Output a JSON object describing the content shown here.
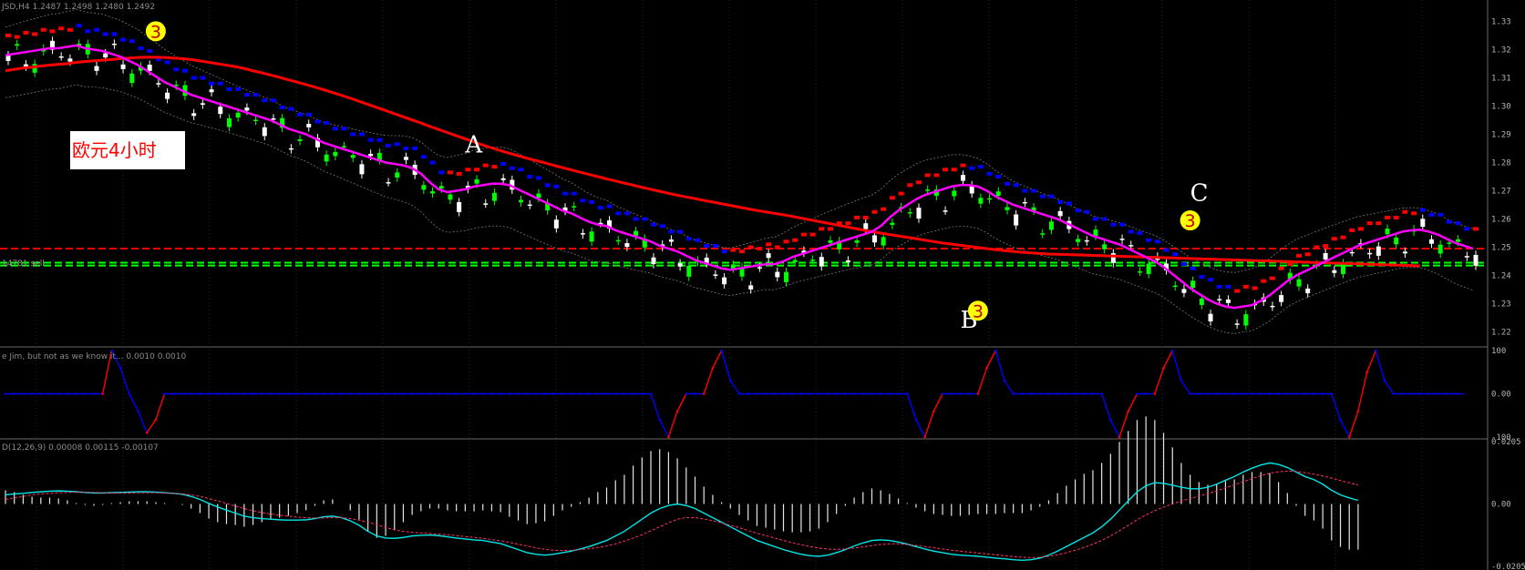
{
  "main": {
    "symbol_title": "JSD,H4  1.2487 1.2498 1.2480 1.2492",
    "note_label": "欧元4小时",
    "point_labels": [
      "A",
      "B",
      "C"
    ],
    "wave_marks": [
      "3",
      "3",
      "3"
    ],
    "sell_label": "14781 sell",
    "price_labels": [
      "1.33",
      "1.32",
      "1.31",
      "1.30",
      "1.29",
      "1.28",
      "1.27",
      "1.26",
      "1.25",
      "1.24",
      "1.23",
      "1.22"
    ]
  },
  "indicator1": {
    "title": "e Jim, but not as we know it...  0.0010 0.0010",
    "axis_labels": [
      "100",
      "0.00",
      "-100"
    ]
  },
  "indicator2": {
    "title": "D(12,26,9)  0.00008  0.00115  -0.00107",
    "axis_labels": [
      "0.0205",
      "0.00",
      "-0.0205"
    ]
  },
  "colors": {
    "background": "#000000",
    "bull_candle": "#ffffff",
    "bear_candle": "#00ff00",
    "ma_slow": "#ff0000",
    "ma_fast": "#ff00ff",
    "trail_down": "#0000ff",
    "trail_up": "#ff0000",
    "macd_line": "#00e5e5",
    "signal_line": "#ff3366",
    "level_red": "#ff0000",
    "level_green": "#00ff00",
    "wave_marker": "#ffff00"
  },
  "chart_data": [
    {
      "type": "line",
      "title": "",
      "ylim": [
        1.215,
        1.335
      ],
      "x_range": [
        0,
        156
      ],
      "series": [
        {
          "values": [
            1.318,
            1.3185,
            1.319,
            1.3195,
            1.32,
            1.3205,
            1.3205,
            1.321,
            1.3215,
            1.3205,
            1.32,
            1.3195,
            1.3185,
            1.3175,
            1.316,
            1.3145,
            1.3125,
            1.3105,
            1.3085,
            1.307,
            1.3055,
            1.304,
            1.303,
            1.302,
            1.301,
            1.3,
            1.299,
            1.298,
            1.297,
            1.296,
            1.295,
            1.2935,
            1.292,
            1.291,
            1.29,
            1.2885,
            1.287,
            1.286,
            1.285,
            1.284,
            1.283,
            1.282,
            1.281,
            1.28,
            1.2795,
            1.279,
            1.278,
            1.276,
            1.273,
            1.2705,
            1.2695,
            1.27,
            1.2705,
            1.2715,
            1.272,
            1.2725,
            1.2725,
            1.272,
            1.2705,
            1.269,
            1.2675,
            1.266,
            1.2645,
            1.263,
            1.262,
            1.2605,
            1.259,
            1.258,
            1.2575,
            1.256,
            1.255,
            1.254,
            1.253,
            1.252,
            1.2505,
            1.2495,
            1.2485,
            1.247,
            1.2455,
            1.2445,
            1.2435,
            1.2425,
            1.242,
            1.2425,
            1.243,
            1.2435,
            1.244,
            1.244,
            1.245,
            1.2465,
            1.2475,
            1.2485,
            1.2495,
            1.2505,
            1.2515,
            1.2525,
            1.2535,
            1.2545,
            1.2555,
            1.2575,
            1.2605,
            1.263,
            1.265,
            1.267,
            1.2685,
            1.2695,
            1.2705,
            1.2715,
            1.272,
            1.272,
            1.2715,
            1.27,
            1.268,
            1.2665,
            1.265,
            1.264,
            1.263,
            1.262,
            1.261,
            1.26,
            1.2585,
            1.257,
            1.2555,
            1.254,
            1.253,
            1.252,
            1.251,
            1.2495,
            1.248,
            1.2465,
            1.245,
            1.243,
            1.2405,
            1.238,
            1.2355,
            1.2335,
            1.2315,
            1.23,
            1.229,
            1.2285,
            1.229,
            1.2295,
            1.231,
            1.233,
            1.2355,
            1.238,
            1.24,
            1.2415,
            1.243,
            1.2445,
            1.246,
            1.2475,
            1.249,
            1.2505,
            1.2515,
            1.2525,
            1.2535,
            1.2545,
            1.2555,
            1.256,
            1.2562,
            1.2555,
            1.2545,
            1.253,
            1.2515,
            1.2505,
            1.2495
          ]
        },
        {
          "values": [
            1.3125,
            1.313,
            1.3135,
            1.3138,
            1.3142,
            1.3145,
            1.3148,
            1.315,
            1.3155,
            1.3158,
            1.316,
            1.3163,
            1.3165,
            1.3168,
            1.317,
            1.3172,
            1.3173,
            1.3173,
            1.3172,
            1.317,
            1.3168,
            1.3165,
            1.316,
            1.3155,
            1.315,
            1.3145,
            1.314,
            1.3133,
            1.3125,
            1.3118,
            1.311,
            1.3102,
            1.3093,
            1.3085,
            1.3076,
            1.3067,
            1.3058,
            1.3048,
            1.3038,
            1.3028,
            1.3017,
            1.3006,
            1.2995,
            1.2984,
            1.2973,
            1.2962,
            1.2951,
            1.294,
            1.2928,
            1.2917,
            1.2906,
            1.2895,
            1.2884,
            1.2873,
            1.2862,
            1.2852,
            1.2842,
            1.2833,
            1.2824,
            1.2815,
            1.2807,
            1.2799,
            1.279,
            1.2782,
            1.2774,
            1.2766,
            1.2758,
            1.275,
            1.2742,
            1.2735,
            1.2727,
            1.272,
            1.2712,
            1.2705,
            1.2698,
            1.2691,
            1.2684,
            1.2678,
            1.2672,
            1.2666,
            1.266,
            1.2654,
            1.2648,
            1.2642,
            1.2636,
            1.263,
            1.2625,
            1.262,
            1.2615,
            1.2609,
            1.2603,
            1.2597,
            1.2591,
            1.2585,
            1.2579,
            1.2573,
            1.2567,
            1.2561,
            1.2555,
            1.255,
            1.2545,
            1.254,
            1.2535,
            1.253,
            1.2525,
            1.252,
            1.2515,
            1.2511,
            1.2507,
            1.2503,
            1.2499,
            1.2495,
            1.2491,
            1.2488,
            1.2485,
            1.2482,
            1.248,
            1.2478,
            1.2476,
            1.2475,
            1.2474,
            1.2473,
            1.2472,
            1.2471,
            1.247,
            1.2469,
            1.2468,
            1.2467,
            1.2466,
            1.2465,
            1.2464,
            1.2463,
            1.2462,
            1.2461,
            1.246,
            1.2459,
            1.2458,
            1.2457,
            1.2456,
            1.2455,
            1.2454,
            1.2453,
            1.2452,
            1.2451,
            1.245,
            1.2449,
            1.2448,
            1.2447,
            1.2446,
            1.2445,
            1.2444,
            1.2443,
            1.2442,
            1.2441,
            1.244,
            1.2439,
            1.2438,
            1.2437,
            1.2436,
            1.2435,
            1.2434
          ]
        }
      ],
      "horizontal_levels": [
        1.2495,
        1.2435,
        1.2445
      ]
    },
    {
      "type": "line",
      "title": "",
      "ylim": [
        -100,
        100
      ],
      "series": [
        {
          "values": [
            0,
            0,
            0,
            0,
            0,
            0,
            0,
            0,
            0,
            0,
            0,
            0,
            100,
            60,
            0,
            -40,
            -90,
            -60,
            0,
            0,
            0,
            0,
            0,
            0,
            0,
            0,
            0,
            0,
            0,
            0,
            0,
            0,
            0,
            0,
            0,
            0,
            0,
            0,
            0,
            0,
            0,
            0,
            0,
            0,
            0,
            0,
            0,
            0,
            0,
            0,
            0,
            0,
            0,
            0,
            0,
            0,
            0,
            0,
            0,
            0,
            0,
            0,
            0,
            0,
            0,
            0,
            0,
            0,
            0,
            0,
            0,
            0,
            0,
            0,
            -60,
            -100,
            -40,
            0,
            0,
            0,
            60,
            100,
            30,
            0,
            0,
            0,
            0,
            0,
            0,
            0,
            0,
            0,
            0,
            0,
            0,
            0,
            0,
            0,
            0,
            0,
            0,
            0,
            0,
            -60,
            -100,
            -40,
            0,
            0,
            0,
            0,
            0,
            60,
            100,
            30,
            0,
            0,
            0,
            0,
            0,
            0,
            0,
            0,
            0,
            0,
            0,
            -60,
            -100,
            -40,
            0,
            0,
            0,
            60,
            100,
            30,
            0,
            0,
            0,
            0,
            0,
            0,
            0,
            0,
            0,
            0,
            0,
            0,
            0,
            0,
            0,
            0,
            0,
            -60,
            -100,
            -40,
            50,
            100,
            30,
            0,
            0,
            0,
            0,
            0,
            0,
            0,
            0,
            0
          ]
        }
      ]
    },
    {
      "type": "line",
      "title": "",
      "ylim": [
        -0.0205,
        0.0205
      ],
      "series": [
        {
          "values": [
            0.003,
            0.0033,
            0.0035,
            0.0038,
            0.004,
            0.0042,
            0.0043,
            0.0042,
            0.004,
            0.0038,
            0.0036,
            0.0036,
            0.0037,
            0.0038,
            0.0039,
            0.004,
            0.004,
            0.0039,
            0.0037,
            0.0035,
            0.0032,
            0.0025,
            0.0015,
            0.0002,
            -0.001,
            -0.002,
            -0.003,
            -0.004,
            -0.0045,
            -0.0048,
            -0.005,
            -0.0052,
            -0.0053,
            -0.0053,
            -0.0052,
            -0.0048,
            -0.0042,
            -0.004,
            -0.0045,
            -0.0055,
            -0.007,
            -0.009,
            -0.0105,
            -0.0112,
            -0.0113,
            -0.011,
            -0.0105,
            -0.0103,
            -0.0102,
            -0.0104,
            -0.0108,
            -0.0112,
            -0.0115,
            -0.0118,
            -0.012,
            -0.0125,
            -0.013,
            -0.014,
            -0.015,
            -0.016,
            -0.0165,
            -0.0168,
            -0.0165,
            -0.016,
            -0.0155,
            -0.0148,
            -0.014,
            -0.013,
            -0.012,
            -0.0105,
            -0.009,
            -0.007,
            -0.005,
            -0.003,
            -0.0015,
            -0.0005,
            0,
            -0.0005,
            -0.0015,
            -0.003,
            -0.0045,
            -0.006,
            -0.0075,
            -0.009,
            -0.0105,
            -0.012,
            -0.013,
            -0.014,
            -0.015,
            -0.0158,
            -0.0165,
            -0.017,
            -0.0172,
            -0.0168,
            -0.016,
            -0.015,
            -0.0138,
            -0.0128,
            -0.012,
            -0.0118,
            -0.012,
            -0.0125,
            -0.0132,
            -0.014,
            -0.0148,
            -0.0155,
            -0.016,
            -0.0165,
            -0.0168,
            -0.017,
            -0.0172,
            -0.0175,
            -0.0178,
            -0.018,
            -0.0183,
            -0.0185,
            -0.0183,
            -0.0178,
            -0.0168,
            -0.0155,
            -0.014,
            -0.0125,
            -0.011,
            -0.0095,
            -0.0075,
            -0.005,
            -0.002,
            0.001,
            0.004,
            0.006,
            0.007,
            0.0068,
            0.0062,
            0.0055,
            0.005,
            0.005,
            0.0055,
            0.0065,
            0.0078,
            0.009,
            0.0105,
            0.0118,
            0.0128,
            0.0135,
            0.013,
            0.012,
            0.0105,
            0.009,
            0.008,
            0.0065,
            0.0045,
            0.003,
            0.002,
            0.0012
          ]
        },
        {
          "values": [
            0.0015,
            0.002,
            0.0025,
            0.003,
            0.0033,
            0.0035,
            0.0037,
            0.0038,
            0.0039,
            0.0039,
            0.0038,
            0.0037,
            0.0036,
            0.0036,
            0.0036,
            0.0037,
            0.0037,
            0.0037,
            0.0036,
            0.0035,
            0.0033,
            0.003,
            0.0025,
            0.0018,
            0.001,
            0.0002,
            -0.0007,
            -0.0015,
            -0.0022,
            -0.0028,
            -0.0033,
            -0.0037,
            -0.004,
            -0.0043,
            -0.0045,
            -0.0046,
            -0.0046,
            -0.0045,
            -0.0045,
            -0.0048,
            -0.0053,
            -0.006,
            -0.0068,
            -0.0077,
            -0.0085,
            -0.009,
            -0.0093,
            -0.0095,
            -0.0097,
            -0.0099,
            -0.0101,
            -0.0104,
            -0.0107,
            -0.011,
            -0.0113,
            -0.0117,
            -0.0121,
            -0.0126,
            -0.0132,
            -0.0138,
            -0.0144,
            -0.0149,
            -0.0152,
            -0.0153,
            -0.0152,
            -0.015,
            -0.0147,
            -0.0143,
            -0.0138,
            -0.0131,
            -0.0122,
            -0.0112,
            -0.0101,
            -0.0088,
            -0.0075,
            -0.0062,
            -0.005,
            -0.0045,
            -0.0045,
            -0.0049,
            -0.0055,
            -0.0062,
            -0.007,
            -0.0078,
            -0.0087,
            -0.0096,
            -0.0104,
            -0.0112,
            -0.012,
            -0.0127,
            -0.0134,
            -0.014,
            -0.0145,
            -0.0148,
            -0.0149,
            -0.0148,
            -0.0145,
            -0.0141,
            -0.0137,
            -0.0133,
            -0.0131,
            -0.0131,
            -0.0133,
            -0.0136,
            -0.014,
            -0.0144,
            -0.0148,
            -0.0152,
            -0.0155,
            -0.0158,
            -0.0161,
            -0.0164,
            -0.0167,
            -0.017,
            -0.0173,
            -0.0175,
            -0.0176,
            -0.0175,
            -0.0172,
            -0.0167,
            -0.016,
            -0.0152,
            -0.0143,
            -0.0132,
            -0.012,
            -0.0105,
            -0.0088,
            -0.007,
            -0.0052,
            -0.0036,
            -0.0022,
            -0.001,
            0,
            0.001,
            0.0018,
            0.0026,
            0.0034,
            0.0043,
            0.0053,
            0.0063,
            0.0073,
            0.0083,
            0.0093,
            0.0101,
            0.0106,
            0.0108,
            0.0107,
            0.0103,
            0.0098,
            0.0092,
            0.0085,
            0.0077,
            0.007,
            0.0062
          ]
        }
      ]
    }
  ]
}
